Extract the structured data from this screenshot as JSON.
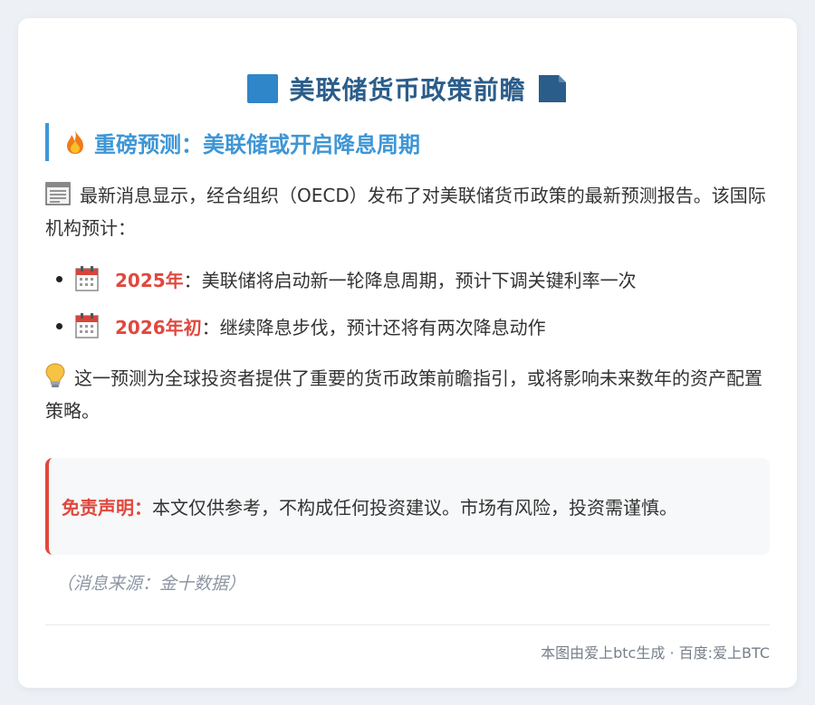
{
  "header": {
    "title": "美联储货币政策前瞻"
  },
  "section": {
    "heading": "重磅预测：美联储或开启降息周期"
  },
  "intro": {
    "text": "最新消息显示，经合组织（OECD）发布了对美联储货币政策的最新预测报告。该国际机构预计："
  },
  "forecasts": [
    {
      "date": "2025年",
      "text": "：美联储将启动新一轮降息周期，预计下调关键利率一次"
    },
    {
      "date": "2026年初",
      "text": "：继续降息步伐，预计还将有两次降息动作"
    }
  ],
  "insight": {
    "text": "这一预测为全球投资者提供了重要的货币政策前瞻指引，或将影响未来数年的资产配置策略。"
  },
  "disclaimer": {
    "label": "免责声明：",
    "text": "本文仅供参考，不构成任何投资建议。市场有风险，投资需谨慎。"
  },
  "source": {
    "text": "（消息来源：金十数据）"
  },
  "footer": {
    "text": "本图由爱上btc生成 · 百度:爱上BTC"
  },
  "colors": {
    "accent_blue": "#3d96d6",
    "title_blue": "#2b5d8a",
    "highlight_red": "#e0483e",
    "background": "#edf1f6"
  },
  "icons": [
    "blue-square-icon",
    "document-icon",
    "fire-icon",
    "newspaper-icon",
    "calendar-icon",
    "lightbulb-icon"
  ]
}
